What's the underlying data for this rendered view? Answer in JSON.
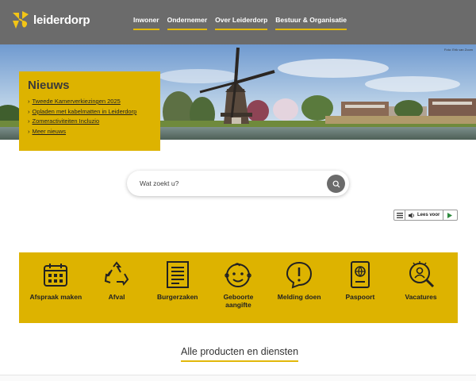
{
  "header": {
    "logo_text": "leiderdorp",
    "nav": [
      "Inwoner",
      "Ondernemer",
      "Over Leiderdorp",
      "Bestuur & Organisatie"
    ]
  },
  "hero": {
    "photo_credit": "Foto: Erik van Zoom"
  },
  "news": {
    "title": "Nieuws",
    "items": [
      "Tweede Kamerverkiezingen 2025",
      "Opladen met kabelmatten in Leiderdorp",
      "Zomeractiviteiten Incluzio",
      "Meer nieuws"
    ]
  },
  "search": {
    "placeholder": "Wat zoekt u?",
    "icon": "search-icon"
  },
  "readspeaker": {
    "label": "Lees voor",
    "icons": [
      "menu-icon",
      "speaker-icon",
      "play-icon"
    ]
  },
  "quick_links": [
    {
      "label": "Afspraak maken",
      "icon": "calendar-icon"
    },
    {
      "label": "Afval",
      "icon": "recycle-icon"
    },
    {
      "label": "Burgerzaken",
      "icon": "document-icon"
    },
    {
      "label": "Geboorte aangifte",
      "icon": "baby-icon"
    },
    {
      "label": "Melding doen",
      "icon": "alert-icon"
    },
    {
      "label": "Paspoort",
      "icon": "passport-icon"
    },
    {
      "label": "Vacatures",
      "icon": "job-search-icon"
    }
  ],
  "all_products": "Alle producten en diensten",
  "colors": {
    "header_bg": "#6b6b6b",
    "accent": "#ddb300",
    "underline": "#e2b80a"
  }
}
